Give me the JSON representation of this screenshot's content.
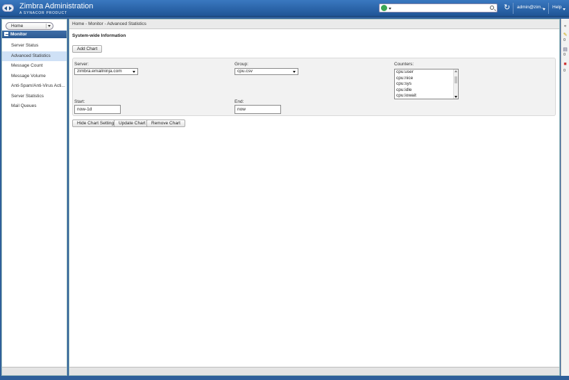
{
  "header": {
    "app_title": "Zimbra Administration",
    "app_subtitle": "A SYNACOR PRODUCT",
    "user_label": "admin@zim...",
    "help_label": "Help",
    "search": {
      "value": "",
      "placeholder": ""
    }
  },
  "sidebar": {
    "home_select": "Home",
    "section_title": "Monitor",
    "items": [
      {
        "label": "Server Status"
      },
      {
        "label": "Advanced Statistics"
      },
      {
        "label": "Message Count"
      },
      {
        "label": "Message Volume"
      },
      {
        "label": "Anti-Spam/Anti-Virus Acti..."
      },
      {
        "label": "Server Statistics"
      },
      {
        "label": "Mail Queues"
      }
    ],
    "active_index": 1
  },
  "main": {
    "breadcrumb": "Home - Monitor - Advanced Statistics",
    "heading": "System-wide Information",
    "add_chart_label": "Add Chart",
    "server_label": "Server:",
    "server_value": "zimbra.emailninja.com",
    "group_label": "Group:",
    "group_value": "cpu.csv",
    "counters_label": "Counters:",
    "counters": [
      "cpu:user",
      "cpu:nice",
      "cpu:sys",
      "cpu:idle",
      "cpu:iowait"
    ],
    "start_label": "Start:",
    "start_value": "now-1d",
    "end_label": "End:",
    "end_value": "now",
    "hide_settings_label": "Hide Chart Settings",
    "update_chart_label": "Update Chart",
    "remove_chart_label": "Remove Chart"
  },
  "rail": {
    "counts": [
      "0",
      "0",
      "0"
    ],
    "collapse_label": "«"
  }
}
